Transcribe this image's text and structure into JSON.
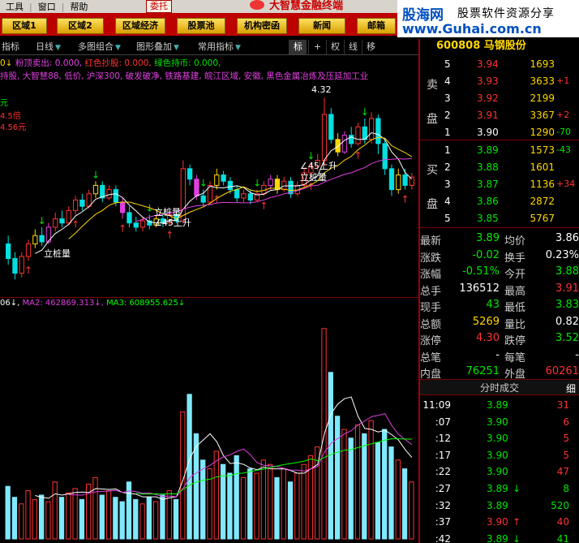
{
  "menu": {
    "items": [
      "工具",
      "窗口",
      "帮助"
    ],
    "delegate": "委托",
    "brand": "大智慧金融终端"
  },
  "nav": {
    "buttons": [
      "区域1",
      "区域2",
      "区域经济",
      "股票池",
      "机构密函",
      "新闻",
      "邮箱"
    ]
  },
  "watermark": {
    "logo": "股海网",
    "slogan": "股票软件资源分享",
    "url": "www.Guhai.com.cn"
  },
  "toolbar": {
    "indicator": "指标",
    "period": "日线",
    "multi": "多图组合",
    "overlay": "图形叠加",
    "common": "常用指标",
    "mode_buttons": [
      "标",
      "+",
      "权",
      "线",
      "移"
    ]
  },
  "indicator_line1": {
    "prefix": "0↓",
    "items": [
      {
        "text": "粉顶卖出: 0.000,",
        "color": "#e040e0"
      },
      {
        "text": "红色抄股: 0.000,",
        "color": "#ff3232"
      },
      {
        "text": "绿色持币: 0.000,",
        "color": "#00e600"
      }
    ]
  },
  "indicator_line2": "持股, 大智慧88, 低价, 沪深300, 破发破净, 铁路基建, 皖江区域, 安徽, 黑色金属冶炼及压延加工业",
  "side_labels": [
    "元",
    "4.5倍",
    "4.56元"
  ],
  "chart_labels": {
    "lizhuang": "立桩量",
    "up45": "∠45上升",
    "top_value": "4.32"
  },
  "ma_line": {
    "prefix": "06↓,",
    "ma2": "MA2: 462869.313↓,",
    "ma3": "MA3: 608955.625↓"
  },
  "chart_data": {
    "type": "candlestick",
    "candles": [
      [
        3.62,
        3.55,
        3.66,
        3.52
      ],
      [
        3.55,
        3.48,
        3.58,
        3.45
      ],
      [
        3.48,
        3.56,
        3.58,
        3.46
      ],
      [
        3.56,
        3.62,
        3.64,
        3.54
      ],
      [
        3.62,
        3.66,
        3.69,
        3.6
      ],
      [
        3.66,
        3.63,
        3.7,
        3.61
      ],
      [
        3.63,
        3.7,
        3.72,
        3.62
      ],
      [
        3.7,
        3.74,
        3.77,
        3.68
      ],
      [
        3.74,
        3.72,
        3.78,
        3.7
      ],
      [
        3.72,
        3.78,
        3.8,
        3.71
      ],
      [
        3.78,
        3.83,
        3.85,
        3.76
      ],
      [
        3.83,
        3.8,
        3.86,
        3.78
      ],
      [
        3.8,
        3.86,
        3.88,
        3.79
      ],
      [
        3.86,
        3.9,
        3.92,
        3.84
      ],
      [
        3.9,
        3.84,
        3.92,
        3.82
      ],
      [
        3.84,
        3.88,
        3.9,
        3.83
      ],
      [
        3.88,
        3.82,
        3.9,
        3.8
      ],
      [
        3.82,
        3.77,
        3.84,
        3.74
      ],
      [
        3.77,
        3.72,
        3.8,
        3.7
      ],
      [
        3.72,
        3.7,
        3.75,
        3.68
      ],
      [
        3.7,
        3.73,
        3.75,
        3.68
      ],
      [
        3.73,
        3.71,
        3.76,
        3.69
      ],
      [
        3.71,
        3.74,
        3.76,
        3.7
      ],
      [
        3.74,
        3.72,
        3.77,
        3.7
      ],
      [
        3.72,
        3.76,
        3.78,
        3.71
      ],
      [
        3.76,
        3.73,
        3.78,
        3.72
      ],
      [
        3.73,
        3.98,
        4.02,
        3.72
      ],
      [
        3.98,
        3.93,
        4.0,
        3.9
      ],
      [
        3.93,
        3.85,
        3.95,
        3.83
      ],
      [
        3.85,
        3.82,
        3.88,
        3.8
      ],
      [
        3.82,
        3.9,
        3.92,
        3.81
      ],
      [
        3.9,
        3.95,
        3.98,
        3.88
      ],
      [
        3.95,
        3.92,
        3.97,
        3.9
      ],
      [
        3.92,
        3.88,
        3.94,
        3.86
      ],
      [
        3.88,
        3.84,
        3.9,
        3.82
      ],
      [
        3.84,
        3.86,
        3.88,
        3.82
      ],
      [
        3.86,
        3.83,
        3.88,
        3.81
      ],
      [
        3.83,
        3.86,
        3.88,
        3.82
      ],
      [
        3.86,
        3.9,
        3.92,
        3.85
      ],
      [
        3.9,
        3.93,
        3.95,
        3.88
      ],
      [
        3.93,
        3.88,
        3.95,
        3.86
      ],
      [
        3.88,
        3.92,
        3.94,
        3.87
      ],
      [
        3.92,
        3.86,
        3.94,
        3.84
      ],
      [
        3.86,
        3.9,
        3.92,
        3.85
      ],
      [
        3.9,
        3.96,
        3.98,
        3.89
      ],
      [
        3.96,
        3.99,
        4.01,
        3.94
      ],
      [
        3.99,
        4.02,
        4.05,
        3.97
      ],
      [
        4.02,
        4.24,
        4.32,
        4.0
      ],
      [
        4.24,
        4.12,
        4.27,
        4.1
      ],
      [
        4.12,
        4.06,
        4.15,
        4.04
      ],
      [
        4.06,
        4.14,
        4.16,
        4.05
      ],
      [
        4.14,
        4.1,
        4.18,
        4.08
      ],
      [
        4.1,
        4.18,
        4.2,
        4.09
      ],
      [
        4.18,
        4.12,
        4.22,
        4.1
      ],
      [
        4.12,
        4.22,
        4.25,
        4.1
      ],
      [
        4.22,
        4.1,
        4.24,
        4.05
      ],
      [
        4.1,
        3.98,
        4.12,
        3.95
      ],
      [
        3.98,
        3.88,
        4.0,
        3.85
      ],
      [
        3.88,
        3.95,
        3.98,
        3.86
      ],
      [
        3.95,
        3.9,
        3.98,
        3.88
      ],
      [
        3.9,
        3.94,
        3.96,
        3.88
      ]
    ],
    "volume": [
      120,
      95,
      80,
      110,
      90,
      100,
      85,
      130,
      95,
      105,
      115,
      90,
      125,
      140,
      100,
      110,
      95,
      85,
      130,
      90,
      80,
      95,
      85,
      100,
      110,
      90,
      290,
      330,
      240,
      180,
      160,
      200,
      170,
      150,
      190,
      140,
      160,
      150,
      180,
      170,
      140,
      160,
      130,
      150,
      170,
      190,
      210,
      480,
      380,
      280,
      250,
      230,
      260,
      240,
      270,
      220,
      250,
      210,
      180,
      160,
      130
    ],
    "ma_lines": {
      "MA2": "#e040e0",
      "MA3": "#00ff00",
      "MA1": "#ffffff"
    }
  },
  "stock": {
    "header": "600808 马钢股份"
  },
  "orderbook": {
    "sell_label": [
      "卖",
      "盘"
    ],
    "buy_label": [
      "买",
      "盘"
    ],
    "sell": [
      {
        "level": "5",
        "price": "3.94",
        "vol": "1693",
        "chg": ""
      },
      {
        "level": "4",
        "price": "3.93",
        "vol": "3633",
        "chg": "+1"
      },
      {
        "level": "3",
        "price": "3.92",
        "vol": "2199",
        "chg": ""
      },
      {
        "level": "2",
        "price": "3.91",
        "vol": "3367",
        "chg": "+2"
      },
      {
        "level": "1",
        "price": "3.90",
        "vol": "1290",
        "chg": "-70"
      }
    ],
    "buy": [
      {
        "level": "1",
        "price": "3.89",
        "vol": "1573",
        "chg": "-43"
      },
      {
        "level": "2",
        "price": "3.88",
        "vol": "1601",
        "chg": ""
      },
      {
        "level": "3",
        "price": "3.87",
        "vol": "1136",
        "chg": "+34"
      },
      {
        "level": "4",
        "price": "3.86",
        "vol": "2872",
        "chg": ""
      },
      {
        "level": "5",
        "price": "3.85",
        "vol": "5767",
        "chg": ""
      }
    ]
  },
  "quotes": [
    {
      "l1": "最新",
      "v1": "3.89",
      "c1": "green",
      "l2": "均价",
      "v2": "3.86",
      "c2": "white"
    },
    {
      "l1": "涨跌",
      "v1": "-0.02",
      "c1": "green",
      "l2": "换手",
      "v2": "0.23%",
      "c2": "white"
    },
    {
      "l1": "涨幅",
      "v1": "-0.51%",
      "c1": "green",
      "l2": "今开",
      "v2": "3.88",
      "c2": "green"
    },
    {
      "l1": "总手",
      "v1": "136512",
      "c1": "white",
      "l2": "最高",
      "v2": "3.91",
      "c2": "red"
    },
    {
      "l1": "现手",
      "v1": "43",
      "c1": "green",
      "l2": "最低",
      "v2": "3.83",
      "c2": "green"
    },
    {
      "l1": "总额",
      "v1": "5269",
      "c1": "yellow",
      "l2": "量比",
      "v2": "0.82",
      "c2": "white"
    },
    {
      "l1": "涨停",
      "v1": "4.30",
      "c1": "red",
      "l2": "跌停",
      "v2": "3.52",
      "c2": "green"
    },
    {
      "l1": "总笔",
      "v1": "-",
      "c1": "white",
      "l2": "每笔",
      "v2": "-",
      "c2": "white"
    },
    {
      "l1": "内盘",
      "v1": "76251",
      "c1": "green",
      "l2": "外盘",
      "v2": "60261",
      "c2": "red"
    }
  ],
  "timesales": {
    "title": "分时成交",
    "rows": [
      {
        "t": "11:09",
        "p": "3.89",
        "pc": "green",
        "a": "",
        "v": "31",
        "vc": "red"
      },
      {
        "t": ":07",
        "p": "3.90",
        "pc": "green",
        "a": "",
        "v": "6",
        "vc": "red"
      },
      {
        "t": ":12",
        "p": "3.90",
        "pc": "green",
        "a": "",
        "v": "5",
        "vc": "red"
      },
      {
        "t": ":17",
        "p": "3.90",
        "pc": "green",
        "a": "",
        "v": "5",
        "vc": "red"
      },
      {
        "t": ":22",
        "p": "3.90",
        "pc": "green",
        "a": "",
        "v": "47",
        "vc": "red"
      },
      {
        "t": ":27",
        "p": "3.89",
        "pc": "green",
        "a": "↓",
        "v": "8",
        "vc": "green"
      },
      {
        "t": ":32",
        "p": "3.89",
        "pc": "green",
        "a": "",
        "v": "520",
        "vc": "green"
      },
      {
        "t": ":37",
        "p": "3.90",
        "pc": "red",
        "a": "↑",
        "v": "40",
        "vc": "red"
      },
      {
        "t": ":42",
        "p": "3.89",
        "pc": "green",
        "a": "↓",
        "v": "41",
        "vc": "green"
      }
    ],
    "side_label": "细"
  }
}
